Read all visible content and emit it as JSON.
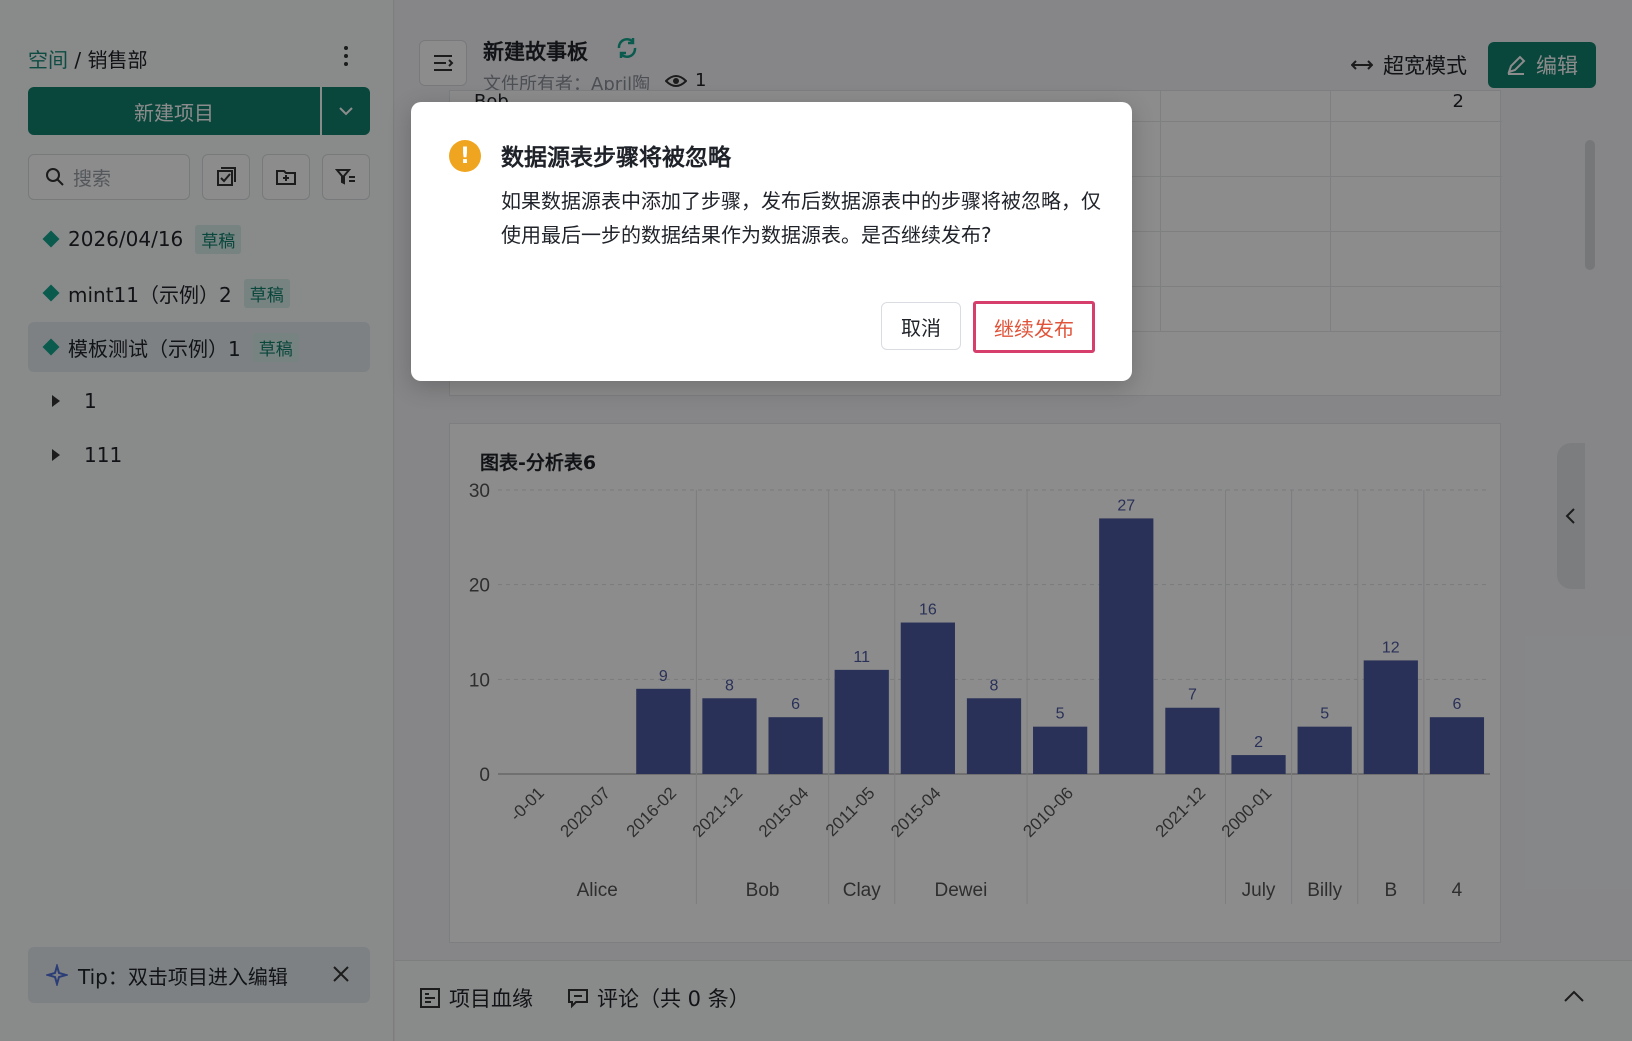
{
  "sidebar": {
    "breadcrumb_space": "空间",
    "breadcrumb_sep": " / ",
    "breadcrumb_dept": "销售部",
    "new_project_label": "新建项目",
    "search_placeholder": "搜索",
    "items": [
      {
        "label": "2026/04/16",
        "badge": "草稿"
      },
      {
        "label": "mint11（示例）2",
        "badge": "草稿"
      },
      {
        "label": "模板测试（示例）1",
        "badge": "草稿"
      }
    ],
    "folders": [
      {
        "label": "1"
      },
      {
        "label": "111"
      }
    ],
    "tip": "Tip：双击项目进入编辑"
  },
  "header": {
    "title": "新建故事板",
    "owner": "文件所有者：April陶",
    "views": "1",
    "wide_mode": "超宽模式",
    "edit": "编辑"
  },
  "table_peek": {
    "row_label": "Bob",
    "row_value": "2"
  },
  "chart": {
    "title": "图表-分析表6"
  },
  "chart_data": {
    "type": "bar",
    "title": "图表-分析表6",
    "ylim": [
      0,
      30
    ],
    "yticks": [
      0,
      10,
      20,
      30
    ],
    "grid": true,
    "color": "#4e5aa0",
    "categories": [
      "-0-01",
      "2020-07",
      "2016-02",
      "2021-12",
      "2015-04",
      "2011-05",
      "2015-04",
      "2010-06",
      "",
      "2021-12",
      "2000-01",
      "",
      "",
      ""
    ],
    "values": [
      null,
      null,
      9,
      8,
      6,
      11,
      16,
      8,
      5,
      27,
      7,
      2,
      5,
      12,
      6
    ],
    "bars": [
      {
        "x": "-0-01",
        "group": "Alice",
        "value": null
      },
      {
        "x": "2020-07",
        "group": "Alice",
        "value": null
      },
      {
        "x": "2016-02",
        "group": "Alice",
        "value": 9
      },
      {
        "x": "2021-12",
        "group": "Bob",
        "value": 8
      },
      {
        "x": "2015-04",
        "group": "Bob",
        "value": 6
      },
      {
        "x": "2011-05",
        "group": "Clay",
        "value": 11
      },
      {
        "x": "2015-04",
        "group": "Dewei",
        "value": 16
      },
      {
        "x": "",
        "group": "Dewei",
        "value": 8
      },
      {
        "x": "2010-06",
        "group": "",
        "value": 5
      },
      {
        "x": "",
        "group": "",
        "value": 27
      },
      {
        "x": "2021-12",
        "group": "",
        "value": 7
      },
      {
        "x": "2000-01",
        "group": "July",
        "value": 2
      },
      {
        "x": "",
        "group": "Billy",
        "value": 5
      },
      {
        "x": "",
        "group": "B",
        "value": 12
      },
      {
        "x": "",
        "group": "4",
        "value": 6
      }
    ],
    "groups": [
      "Alice",
      "Bob",
      "Clay",
      "Dewei",
      "July",
      "Billy",
      "B",
      "4"
    ]
  },
  "bottom": {
    "lineage": "项目血缘",
    "comments": "评论（共 0 条）"
  },
  "modal": {
    "title": "数据源表步骤将被忽略",
    "body": "如果数据源表中添加了步骤，发布后数据源表中的步骤将被忽略，仅使用最后一步的数据结果作为数据源表。是否继续发布?",
    "cancel": "取消",
    "confirm": "继续发布"
  },
  "colors": {
    "brand": "#12806e",
    "bar": "#4e5aa0",
    "warn": "#f0a520",
    "highlight": "#d63e6c"
  }
}
